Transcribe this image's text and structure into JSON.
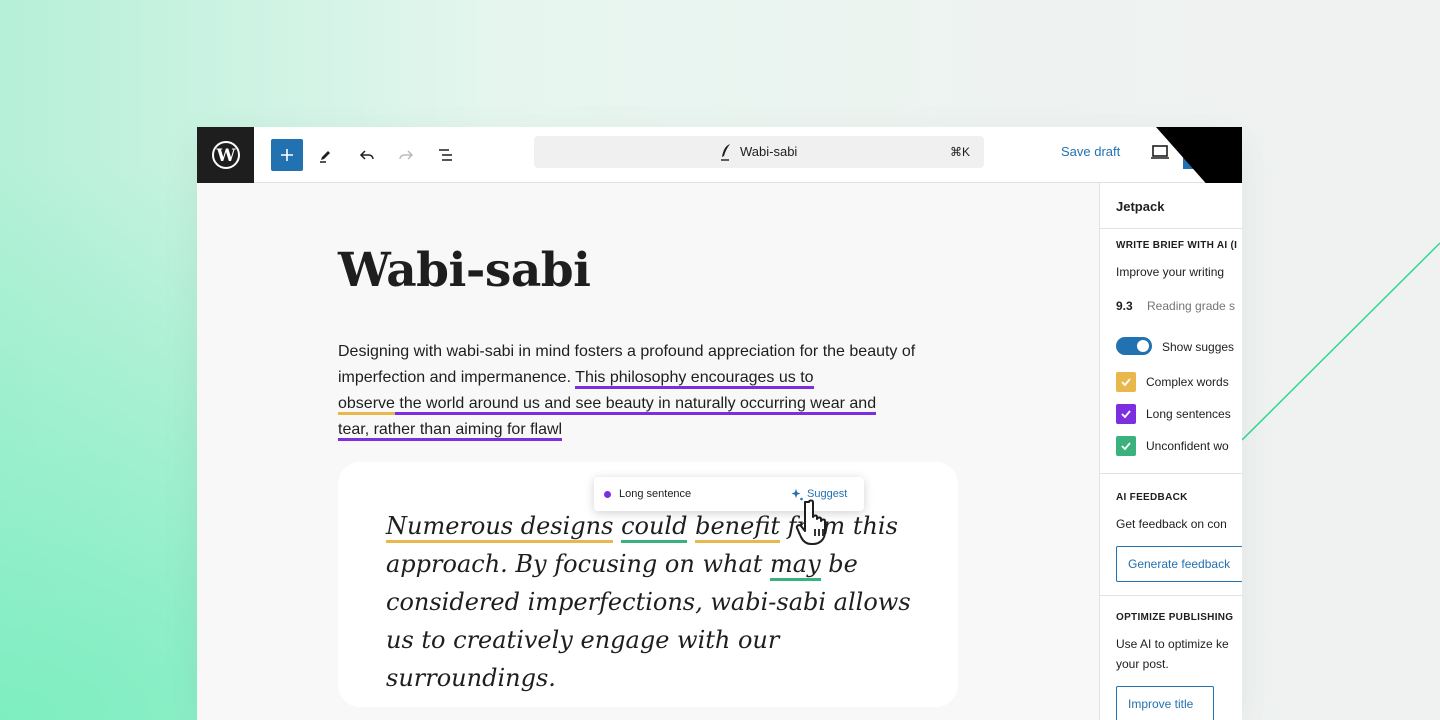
{
  "colors": {
    "accent": "#2271b1",
    "long_sentence": "#7b2fe0",
    "complex_words": "#e9b84d",
    "unconfident_words": "#3bb17e"
  },
  "topbar": {
    "logo_icon": "wordpress-icon",
    "add_icon": "plus-icon",
    "tools_icon": "pencil-icon",
    "undo_icon": "undo-icon",
    "redo_icon": "redo-icon",
    "outline_icon": "list-view-icon",
    "command_bar": {
      "icon": "quill-icon",
      "title": "Wabi-sabi",
      "shortcut": "⌘K"
    },
    "save_draft": "Save draft",
    "preview_icon": "laptop-icon"
  },
  "editor": {
    "title": "Wabi-sabi",
    "paragraph": {
      "plain_start": "Designing with wabi-sabi in mind fosters a profound appreciation for the beauty of imperfection and impermanence. ",
      "long_part1": "This philosophy encourages us to",
      "long_part2_yellow": "observe",
      "long_part3": " the world around us and see beauty in naturally occurring wear and",
      "long_part4": "tear, rather than aiming for flawl"
    },
    "tooltip": {
      "label": "Long sentence",
      "action": "Suggest",
      "action_icon": "sparkle-icon"
    },
    "quote": {
      "w1": "Numerous designs",
      "w2": " ",
      "w3": "could",
      "w4": " ",
      "w5": "benefit",
      "w6": " from this approach. By focusing on what ",
      "w7": "may",
      "w8": " be considered imperfections, wabi-sabi allows us to creatively engage with our surroundings."
    }
  },
  "sidebar": {
    "header": "Jetpack",
    "section1_title": "WRITE BRIEF WITH AI (I",
    "section1_desc": "Improve your writing",
    "grade_value": "9.3",
    "grade_label": "Reading grade s",
    "toggle_label": "Show sugges",
    "checkboxes": [
      {
        "label": "Complex words",
        "checked": true
      },
      {
        "label": "Long sentences",
        "checked": true
      },
      {
        "label": "Unconfident wo",
        "checked": true
      }
    ],
    "section2_title": "AI FEEDBACK",
    "section2_desc": "Get feedback on con",
    "generate_btn": "Generate feedback",
    "section3_title": "OPTIMIZE PUBLISHING",
    "section3_desc1": "Use AI to optimize ke",
    "section3_desc2": "your post.",
    "improve_btn": "Improve title"
  }
}
